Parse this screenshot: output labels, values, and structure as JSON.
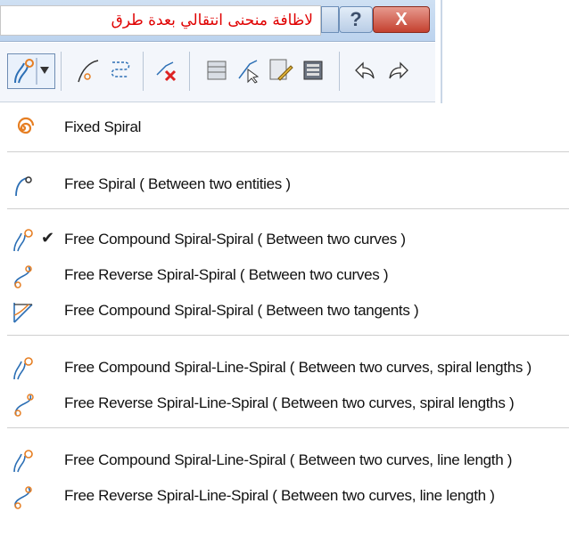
{
  "title_label": "لاظافة منحنى انتقالي بعدة طرق",
  "window_buttons": {
    "help": "?",
    "close": "X"
  },
  "menu": {
    "items": [
      {
        "label": "Fixed Spiral",
        "checked": false
      },
      {
        "label": "Free Spiral ( Between two entities )",
        "checked": false
      },
      {
        "label": "Free Compound Spiral-Spiral ( Between two curves )",
        "checked": true
      },
      {
        "label": "Free Reverse Spiral-Spiral ( Between two curves )",
        "checked": false
      },
      {
        "label": "Free Compound Spiral-Spiral ( Between two tangents )",
        "checked": false
      },
      {
        "label": "Free Compound Spiral-Line-Spiral ( Between two curves, spiral lengths )",
        "checked": false
      },
      {
        "label": "Free Reverse Spiral-Line-Spiral ( Between two curves, spiral lengths )",
        "checked": false
      },
      {
        "label": "Free Compound Spiral-Line-Spiral ( Between two curves, line length )",
        "checked": false
      },
      {
        "label": "Free Reverse Spiral-Line-Spiral ( Between two curves, line length )",
        "checked": false
      }
    ],
    "check_glyph": "✔"
  },
  "colors": {
    "title_text": "#e00000",
    "close_button": "#c4402f",
    "icon_orange": "#e67e22",
    "icon_blue": "#2c6fb5"
  }
}
